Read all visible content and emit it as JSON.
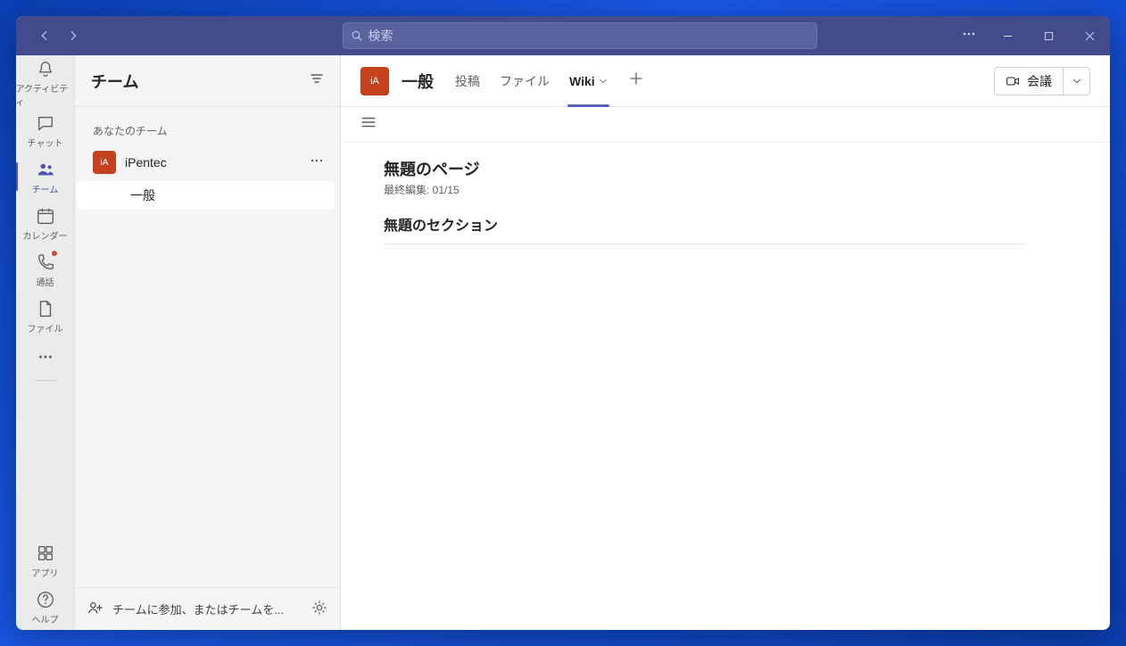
{
  "search": {
    "placeholder": "検索"
  },
  "rail": {
    "activity": "アクティビティ",
    "chat": "チャット",
    "teams": "チーム",
    "calendar": "カレンダー",
    "calls": "通話",
    "files": "ファイル",
    "apps": "アプリ",
    "help": "ヘルプ"
  },
  "panel": {
    "title": "チーム",
    "section_label": "あなたのチーム",
    "team_avatar": "iA",
    "team_name": "iPentec",
    "channels": [
      "一般"
    ],
    "footer_label": "チームに参加、またはチームを..."
  },
  "main": {
    "avatar": "iA",
    "title": "一般",
    "tabs": {
      "posts": "投稿",
      "files": "ファイル",
      "wiki": "Wiki"
    },
    "meet_label": "会議"
  },
  "wiki": {
    "page_title": "無題のページ",
    "last_edited": "最終編集: 01/15",
    "section_title": "無題のセクション"
  }
}
